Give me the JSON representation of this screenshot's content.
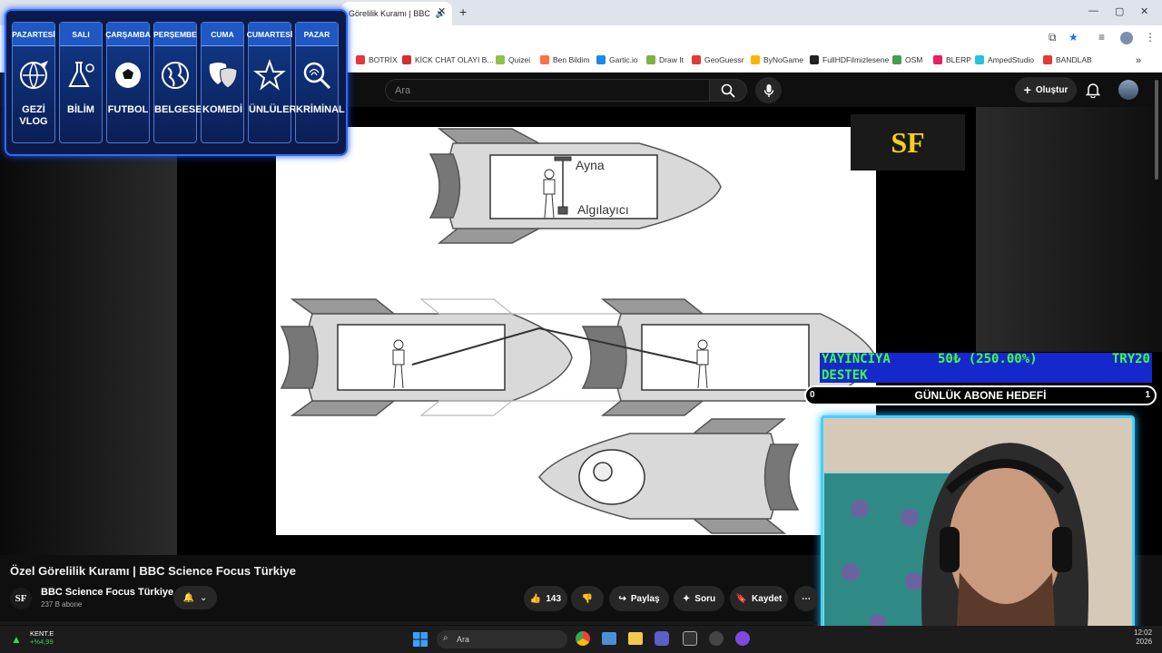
{
  "browser": {
    "tab_title": "Görelilik Kuramı | BBC",
    "tab_close": "✕",
    "new_tab": "+",
    "window_controls": [
      "—",
      "▢",
      "✕"
    ]
  },
  "bookmarks": [
    {
      "label": "BOTRİX",
      "color": "#e53935"
    },
    {
      "label": "KİCK CHAT OLAYI B...",
      "color": "#d32f2f"
    },
    {
      "label": "Quizei",
      "color": "#8bc34a"
    },
    {
      "label": "Ben Bildim",
      "color": "#ff7043"
    },
    {
      "label": "Gartic.io",
      "color": "#1e88e5"
    },
    {
      "label": "Draw It",
      "color": "#7cb342"
    },
    {
      "label": "GeoGuessr",
      "color": "#e53935"
    },
    {
      "label": "ByNoGame",
      "color": "#ffb300"
    },
    {
      "label": "FullHDFilmizlesene",
      "color": "#222222"
    },
    {
      "label": "OSM",
      "color": "#43a047"
    },
    {
      "label": "BLERP",
      "color": "#e91e63"
    },
    {
      "label": "AmpedStudio",
      "color": "#26c6da"
    },
    {
      "label": "BANDLAB",
      "color": "#e53935"
    }
  ],
  "youtube": {
    "search_placeholder": "Ara",
    "create_label": "Oluştur"
  },
  "schedule": [
    {
      "day": "PAZARTESİ",
      "label": "GEZİ VLOG",
      "icon": "globe-plane-icon"
    },
    {
      "day": "SALI",
      "label": "BİLİM",
      "icon": "science-icon"
    },
    {
      "day": "ÇARŞAMBA",
      "label": "FUTBOL",
      "icon": "soccer-ball-icon"
    },
    {
      "day": "PERŞEMBE",
      "label": "BELGESEL",
      "icon": "earth-icon"
    },
    {
      "day": "CUMA",
      "label": "KOMEDİ",
      "icon": "theater-masks-icon"
    },
    {
      "day": "CUMARTESİ",
      "label": "ÜNLÜLER",
      "icon": "star-icon"
    },
    {
      "day": "PAZAR",
      "label": "KRİMİNAL",
      "icon": "fingerprint-icon"
    }
  ],
  "diagram": {
    "mirror_label": "Ayna",
    "detector_label": "Algılayıcı"
  },
  "channel_logo": "SF",
  "donation": {
    "left": "YAYINCIYA",
    "left2": "DESTEK",
    "amount": "50₺ (250.00%)",
    "right": "TRY20"
  },
  "goal": {
    "label": "GÜNLÜK ABONE HEDEFİ",
    "min": "0",
    "max": "1"
  },
  "video": {
    "title": "Özel Görelilik Kuramı | BBC Science Focus Türkiye",
    "channel": "BBC Science Focus Türkiye",
    "subscribers": "237 B abone",
    "likes": "143",
    "share": "Paylaş",
    "ask": "Soru",
    "save": "Kaydet"
  },
  "taskbar": {
    "ticker_name": "KENT.E",
    "ticker_change": "+%4,99",
    "search": "Ara",
    "time": "12:02",
    "year": "2026"
  }
}
